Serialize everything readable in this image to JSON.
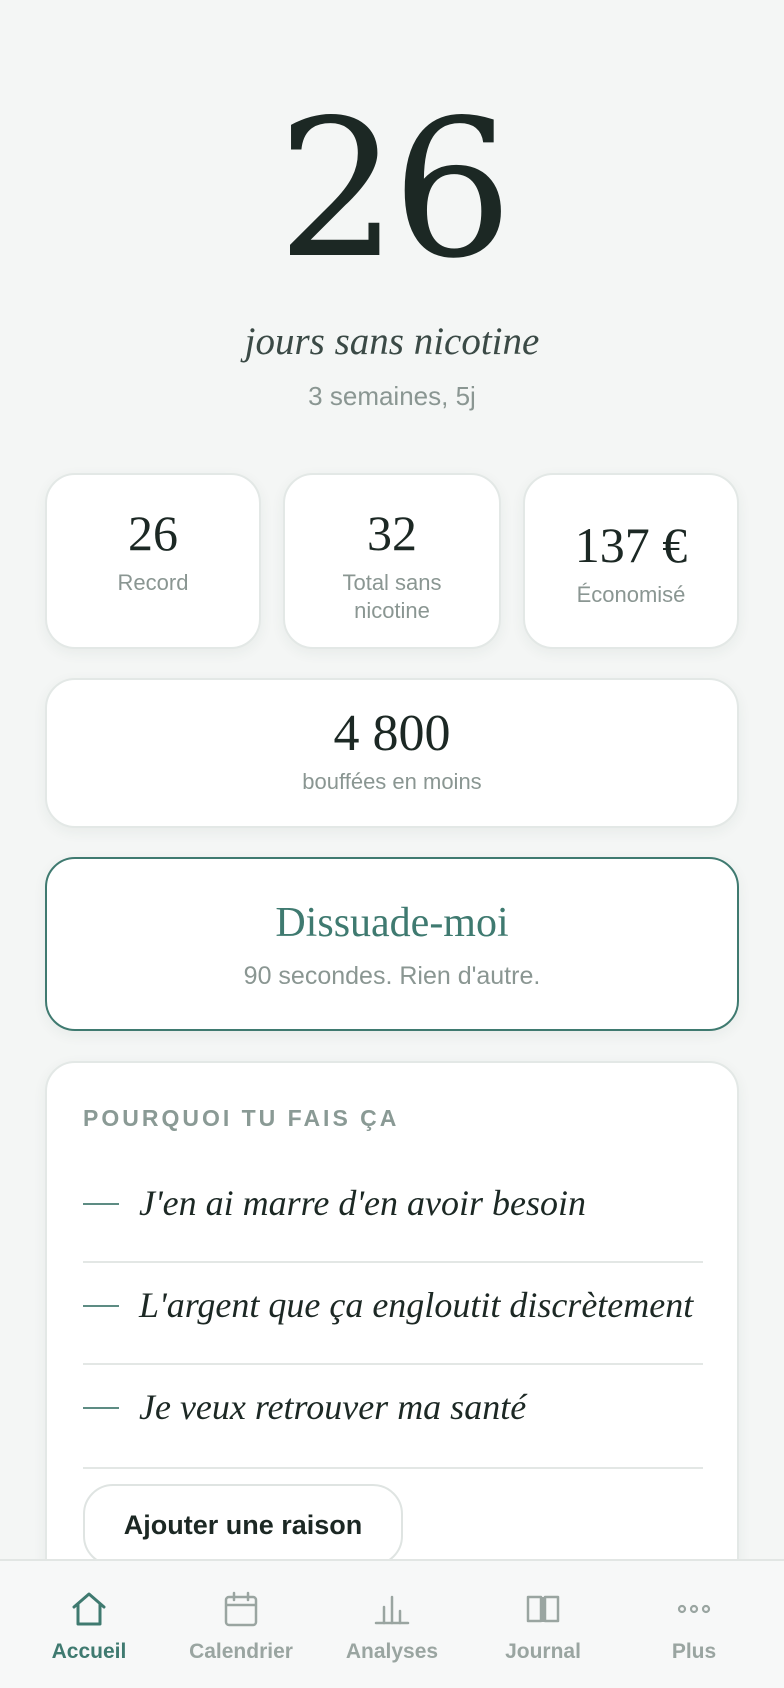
{
  "hero": {
    "days": "26",
    "label": "jours sans nicotine",
    "sub": "3 semaines, 5j"
  },
  "stats": [
    {
      "value": "26",
      "label": "Record"
    },
    {
      "value": "32",
      "label": "Total sans nicotine"
    },
    {
      "value": "137 €",
      "label": "Économisé"
    }
  ],
  "puffs": {
    "value": "4 800",
    "label": "bouffées en moins"
  },
  "dissuade": {
    "title": "Dissuade-moi",
    "sub": "90 secondes. Rien d'autre."
  },
  "reasons": {
    "title": "POURQUOI TU FAIS ÇA",
    "items": [
      "J'en ai marre d'en avoir besoin",
      "L'argent que ça engloutit discrètement",
      "Je veux retrouver ma santé"
    ],
    "add_label": "Ajouter une raison"
  },
  "tabs": [
    {
      "label": "Accueil",
      "icon": "home-icon",
      "active": true
    },
    {
      "label": "Calendrier",
      "icon": "calendar-icon",
      "active": false
    },
    {
      "label": "Analyses",
      "icon": "bar-chart-icon",
      "active": false
    },
    {
      "label": "Journal",
      "icon": "book-icon",
      "active": false
    },
    {
      "label": "Plus",
      "icon": "more-icon",
      "active": false
    }
  ],
  "colors": {
    "accent": "#3f7a70",
    "background": "#f4f6f5",
    "muted": "#8a9692"
  }
}
